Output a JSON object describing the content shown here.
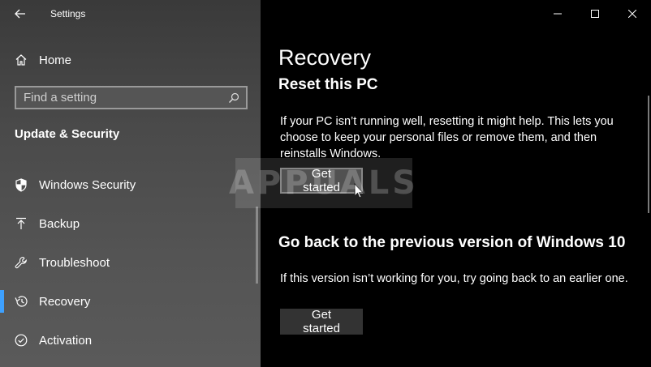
{
  "window": {
    "app_title": "Settings"
  },
  "sidebar": {
    "home_label": "Home",
    "search_placeholder": "Find a setting",
    "section_heading": "Update & Security",
    "items": [
      {
        "label": "Windows Security",
        "icon": "shield-icon"
      },
      {
        "label": "Backup",
        "icon": "backup-arrow-icon"
      },
      {
        "label": "Troubleshoot",
        "icon": "wrench-icon"
      },
      {
        "label": "Recovery",
        "icon": "history-icon",
        "active": true
      },
      {
        "label": "Activation",
        "icon": "check-circle-icon"
      }
    ]
  },
  "main": {
    "page_title": "Recovery",
    "reset": {
      "heading": "Reset this PC",
      "description": "If your PC isn’t running well, resetting it might help. This lets you choose to keep your personal files or remove them, and then reinstalls Windows.",
      "button": "Get started"
    },
    "go_back": {
      "heading": "Go back to the previous version of Windows 10",
      "description": "If this version isn’t working for you, try going back to an earlier one.",
      "button": "Get started"
    }
  },
  "watermark": {
    "text": "APPUALS"
  },
  "colors": {
    "accent": "#3ea1ff",
    "sidebar_bg": "#4a4a4a",
    "main_bg": "#000000",
    "button_bg": "#333333"
  }
}
